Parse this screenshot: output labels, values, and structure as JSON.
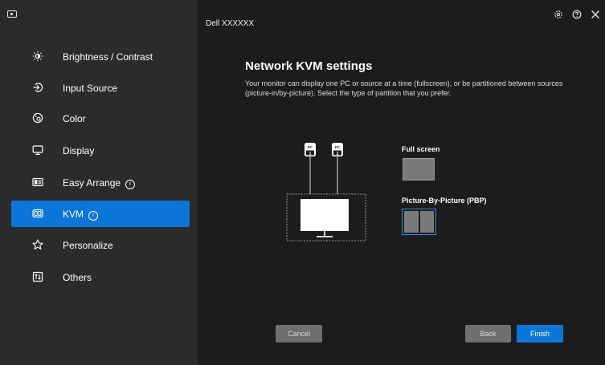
{
  "window": {
    "model_name": "Dell XXXXXX",
    "controls": [
      "settings-icon",
      "help-icon",
      "close-icon"
    ]
  },
  "sidebar": {
    "items": [
      {
        "label": "Brightness / Contrast",
        "icon": "brightness-icon",
        "active": false
      },
      {
        "label": "Input Source",
        "icon": "input-source-icon",
        "active": false
      },
      {
        "label": "Color",
        "icon": "color-icon",
        "active": false
      },
      {
        "label": "Display",
        "icon": "display-icon",
        "active": false
      },
      {
        "label": "Easy Arrange",
        "icon": "easy-arrange-icon",
        "active": false,
        "info": "i"
      },
      {
        "label": "KVM",
        "icon": "kvm-icon",
        "active": true,
        "info": "i"
      },
      {
        "label": "Personalize",
        "icon": "star-icon",
        "active": false
      },
      {
        "label": "Others",
        "icon": "others-icon",
        "active": false
      }
    ],
    "active_color": "#0b76d8"
  },
  "main": {
    "title": "Network KVM settings",
    "description": "Your monitor can display one PC or source at a time (fullscreen), or be partitioned between sources (picture-in/by-picture). Select the type of partition that you prefer.",
    "diagram": {
      "pc1_label": "PC",
      "pc1_number": "1",
      "pc2_label": "PC",
      "pc2_number": "2"
    },
    "options": {
      "full_screen": "Full screen",
      "pbp": "Picture-By-Picture (PBP)",
      "selected": "pbp"
    },
    "buttons": {
      "cancel": "Cancel",
      "back": "Back",
      "finish": "Finish"
    }
  }
}
